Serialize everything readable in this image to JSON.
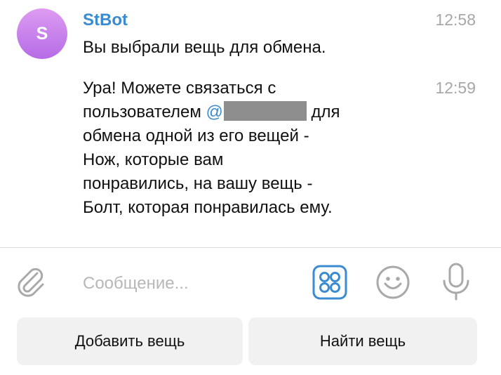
{
  "colors": {
    "accent": "#3a8bd1",
    "avatar_gradient_top": "#dd9cf1",
    "avatar_gradient_bottom": "#b56be6",
    "muted": "#a7a7a7",
    "button_bg": "#f1f1f1"
  },
  "chat": {
    "avatar_letter": "S",
    "sender": "StBot",
    "messages": [
      {
        "time": "12:58",
        "lines": [
          "Вы выбрали вещь для обмена."
        ]
      },
      {
        "time": "12:59",
        "line1": "Ура! Можете связаться с",
        "line2_prefix": "пользователем ",
        "mention": "@",
        "line2_suffix": " для",
        "line3": "обмена одной из его вещей -",
        "line4": "Нож, которые вам",
        "line5": "понравились, на вашу вещь -",
        "line6": "Болт, которая понравилась ему."
      }
    ]
  },
  "composer": {
    "placeholder": "Сообщение...",
    "icons": [
      "paperclip-icon",
      "bot-keyboard-icon",
      "emoji-icon",
      "microphone-icon"
    ]
  },
  "keyboard": {
    "buttons": [
      "Добавить вещь",
      "Найти вещь"
    ]
  }
}
